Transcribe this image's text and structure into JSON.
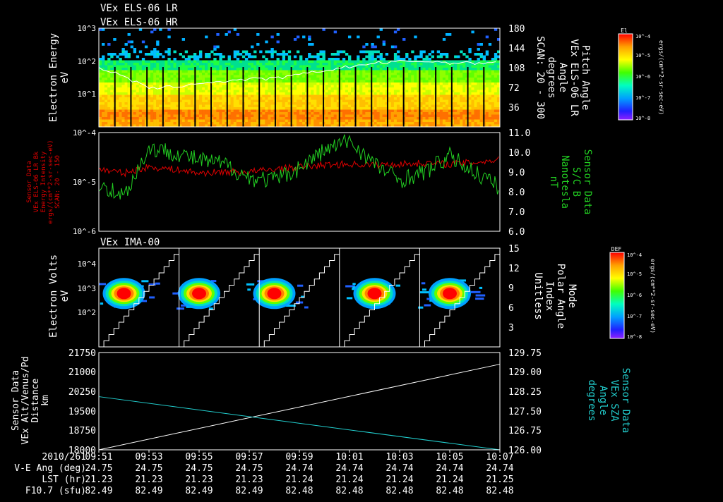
{
  "titles": [
    "VEx ELS-06 LR",
    "VEx ELS-06 HR"
  ],
  "colors": {
    "background": "#000000",
    "axis": "#ffffff",
    "lr_red": "#e00000",
    "b_green": "#22d022",
    "sza_cyan": "#22d0d0"
  },
  "panel1": {
    "ylabel_left": [
      "Electron Energy",
      "eV"
    ],
    "yticks_left": [
      "10^3",
      "10^2",
      "10^1"
    ],
    "ylabel_right": [
      "Pitch Angle",
      "VEx ELS-06 LR",
      "Angle",
      "degrees",
      "SCAN: 20 - 300"
    ],
    "yticks_right": [
      "180",
      "144",
      "108",
      "72",
      "36"
    ],
    "colorbar": {
      "title": "El",
      "ticks": [
        "10^-4",
        "10^-5",
        "10^-6",
        "10^-7",
        "10^-8"
      ],
      "units": "ergs/(cm**2-sr-sec-eV)"
    }
  },
  "panel2": {
    "ylabel_left": [
      "Sensor Data",
      "VEx ELS-06 LR Bk",
      "Energy Intensity",
      "ergs/(cm**2-sr-sec-eV)",
      "SCAN: 20 - 150"
    ],
    "yticks_left": [
      "10^-4",
      "10^-5",
      "10^-6"
    ],
    "ylabel_right": [
      "Sensor Data",
      "S/C B",
      "Nanotesla",
      "nT"
    ],
    "yticks_right": [
      "11.0",
      "10.0",
      "9.0",
      "8.0",
      "7.0",
      "6.0"
    ]
  },
  "panel3": {
    "title": "VEx IMA-00",
    "ylabel_left": [
      "Electron Volts",
      "eV"
    ],
    "yticks_left": [
      "10^4",
      "10^3",
      "10^2"
    ],
    "ylabel_right": [
      "Mode",
      "Polar Angle",
      "Index",
      "Unitless"
    ],
    "yticks_right": [
      "15",
      "12",
      "9",
      "6",
      "3"
    ],
    "colorbar": {
      "title": "DEF",
      "ticks": [
        "10^-4",
        "10^-5",
        "10^-6",
        "10^-7",
        "10^-8"
      ],
      "units": "ergs/(cm**2-sr-sec-eV)"
    }
  },
  "panel4": {
    "ylabel_left": [
      "Sensor Data",
      "VEx Alt/Venus/Pd",
      "Distance",
      "km"
    ],
    "yticks_left": [
      "21750",
      "21000",
      "20250",
      "19500",
      "18750",
      "18000"
    ],
    "ylabel_right": [
      "Sensor Data",
      "VEx SZA",
      "Angle",
      "degrees"
    ],
    "yticks_right": [
      "129.75",
      "129.00",
      "128.25",
      "127.50",
      "126.75",
      "126.00"
    ]
  },
  "footer": {
    "date": "2010/261",
    "times": [
      "09:51",
      "09:53",
      "09:55",
      "09:57",
      "09:59",
      "10:01",
      "10:03",
      "10:05",
      "10:07"
    ],
    "rows": [
      {
        "label": "V-E Ang (deg)",
        "values": [
          "24.75",
          "24.75",
          "24.75",
          "24.75",
          "24.74",
          "24.74",
          "24.74",
          "24.74",
          "24.74"
        ]
      },
      {
        "label": "LST (hr)",
        "values": [
          "21.23",
          "21.23",
          "21.23",
          "21.23",
          "21.24",
          "21.24",
          "21.24",
          "21.24",
          "21.25"
        ]
      },
      {
        "label": "F10.7 (sfu)",
        "values": [
          "82.49",
          "82.49",
          "82.49",
          "82.49",
          "82.48",
          "82.48",
          "82.48",
          "82.48",
          "82.48"
        ]
      }
    ]
  },
  "chart_data": [
    {
      "type": "heatmap",
      "title": "VEx ELS-06 LR / VEx ELS-06 HR",
      "ylabel": "Electron Energy (eV)",
      "ylim": [
        1,
        1000
      ],
      "yscale": "log",
      "xlim": [
        "09:51",
        "10:07"
      ],
      "scan_sweeps": 25,
      "series": [
        {
          "name": "Pitch Angle",
          "axis": "right",
          "ylim": [
            0,
            180
          ],
          "x": [
            "09:51",
            "09:52",
            "09:53",
            "09:54",
            "09:55",
            "09:56",
            "09:57",
            "09:58",
            "09:59",
            "10:00",
            "10:01",
            "10:02",
            "10:03",
            "10:04",
            "10:05",
            "10:06",
            "10:07"
          ],
          "values": [
            108,
            92,
            70,
            73,
            80,
            83,
            87,
            88,
            95,
            103,
            110,
            116,
            119,
            120,
            117,
            116,
            120
          ]
        }
      ]
    },
    {
      "type": "line",
      "x": [
        "09:51",
        "09:52",
        "09:53",
        "09:54",
        "09:55",
        "09:56",
        "09:57",
        "09:58",
        "09:59",
        "10:00",
        "10:01",
        "10:02",
        "10:03",
        "10:04",
        "10:05",
        "10:06",
        "10:07"
      ],
      "series": [
        {
          "name": "VEx ELS-06 LR Bk",
          "axis": "left",
          "yscale": "log",
          "ylim": [
            1e-06,
            0.0001
          ],
          "values": [
            1.8e-05,
            1.5e-05,
            2e-05,
            1.8e-05,
            1.5e-05,
            1.6e-05,
            1.6e-05,
            1.8e-05,
            2e-05,
            2.2e-05,
            2.3e-05,
            2.2e-05,
            2.3e-05,
            2.4e-05,
            2.3e-05,
            2.5e-05,
            2.8e-05
          ]
        },
        {
          "name": "S/C B",
          "axis": "right",
          "ylim": [
            6.0,
            11.0
          ],
          "values": [
            8.4,
            7.8,
            10.2,
            10.0,
            9.6,
            9.4,
            8.7,
            8.6,
            9.2,
            10.1,
            10.6,
            9.4,
            8.6,
            9.0,
            9.8,
            9.0,
            8.2
          ]
        }
      ]
    },
    {
      "type": "heatmap",
      "title": "VEx IMA-00",
      "ylabel": "Electron Volts (eV)",
      "ylim": [
        10,
        50000
      ],
      "yscale": "log",
      "xlim": [
        "09:51",
        "10:07"
      ],
      "blob_centers": [
        "09:52",
        "09:55",
        "09:58",
        "10:02",
        "10:05"
      ],
      "blob_energy_ev": 1000,
      "series": [
        {
          "name": "Polar Angle Index",
          "axis": "right",
          "ylim": [
            0,
            15
          ],
          "pattern": "sawtooth 0-15",
          "cycles": 5
        }
      ]
    },
    {
      "type": "line",
      "x": [
        "09:51",
        "10:07"
      ],
      "series": [
        {
          "name": "VEx Alt/Venus/Pd",
          "axis": "left",
          "ylim": [
            18000,
            21750
          ],
          "values": [
            18000,
            21300
          ]
        },
        {
          "name": "VEx SZA",
          "axis": "right",
          "ylim": [
            126.0,
            129.75
          ],
          "values": [
            128.05,
            126.0
          ]
        }
      ]
    }
  ]
}
